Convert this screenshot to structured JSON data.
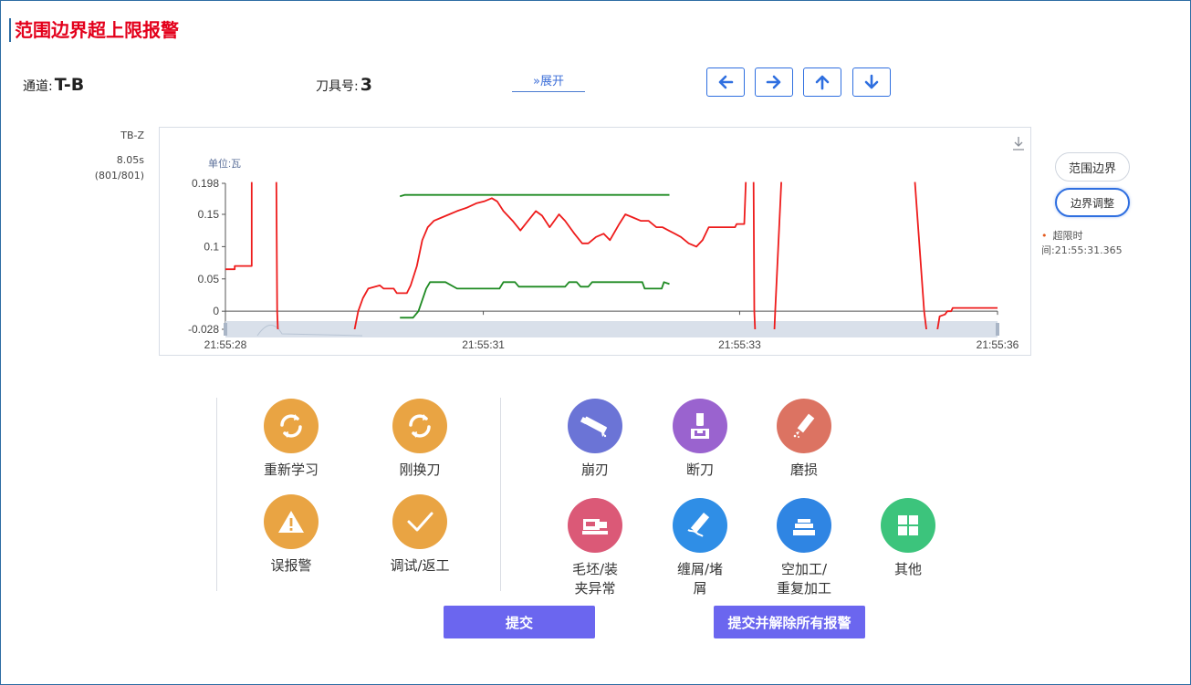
{
  "title": "范围边界超上限报警",
  "channel": {
    "label": "通道:",
    "value": "T-B"
  },
  "tool": {
    "label": "刀具号:",
    "value": "3"
  },
  "expand_label": "»展开",
  "side": {
    "name": "TB-Z",
    "time": "8.05s",
    "count": "(801/801)"
  },
  "buttons": {
    "range": "范围边界",
    "adjust": "边界调整"
  },
  "overlimit": {
    "line1": "超限时",
    "line2": "间:21:55:31.365"
  },
  "options_left": [
    {
      "label": "重新学习",
      "icon": "refresh-icon"
    },
    {
      "label": "刚换刀",
      "icon": "refresh-icon"
    },
    {
      "label": "误报警",
      "icon": "warning-icon"
    },
    {
      "label": "调试/返工",
      "icon": "check-icon"
    }
  ],
  "options_right": [
    {
      "label": "崩刃",
      "icon": "chipped-tool-icon"
    },
    {
      "label": "断刀",
      "icon": "broken-tool-icon"
    },
    {
      "label": "磨损",
      "icon": "wear-icon"
    },
    {
      "label1": "毛坯/装",
      "label2": "夹异常",
      "icon": "blank-clamp-icon"
    },
    {
      "label1": "缠屑/堵",
      "label2": "屑",
      "icon": "chip-jam-icon"
    },
    {
      "label1": "空加工/",
      "label2": "重复加工",
      "icon": "empty-machining-icon"
    },
    {
      "label": "其他",
      "icon": "grid-icon"
    }
  ],
  "colors": {
    "orange": "#e9a443",
    "blue_violet": "#6b74d6",
    "purple": "#9a63cf",
    "salmon": "#dc7362",
    "pink": "#db5977",
    "sky": "#2f8ee6",
    "blue": "#2f85e3",
    "green": "#3cc47c",
    "series_red": "#ee1c1c",
    "series_green": "#1e8a22",
    "submit": "#6b66ef"
  },
  "submit": {
    "label": "提交",
    "label_all": "提交并解除所有报警"
  },
  "chart_data": {
    "type": "line",
    "unit_label": "单位:瓦",
    "x_ticks": [
      "21:55:28",
      "21:55:31",
      "21:55:33",
      "21:55:36"
    ],
    "y_ticks": [
      "0.198",
      "0.15",
      "0.1",
      "0.05",
      "0",
      "-0.028"
    ],
    "ylim": [
      -0.028,
      0.198
    ],
    "series": [
      {
        "color": "#ee1c1c",
        "segments": [
          [
            [
              0.0,
              0.065
            ],
            [
              0.012,
              0.065
            ],
            [
              0.012,
              0.07
            ],
            [
              0.034,
              0.07
            ],
            [
              0.034,
              0.2
            ]
          ],
          [
            [
              0.066,
              0.2
            ],
            [
              0.067,
              0.0
            ],
            [
              0.068,
              -0.03
            ]
          ],
          [
            [
              0.167,
              -0.03
            ],
            [
              0.172,
              0.0
            ],
            [
              0.178,
              0.02
            ],
            [
              0.185,
              0.035
            ],
            [
              0.2,
              0.04
            ],
            [
              0.205,
              0.035
            ],
            [
              0.218,
              0.035
            ],
            [
              0.222,
              0.028
            ],
            [
              0.235,
              0.028
            ],
            [
              0.24,
              0.04
            ],
            [
              0.248,
              0.07
            ],
            [
              0.255,
              0.11
            ],
            [
              0.262,
              0.13
            ],
            [
              0.27,
              0.14
            ],
            [
              0.28,
              0.145
            ],
            [
              0.29,
              0.15
            ],
            [
              0.3,
              0.155
            ],
            [
              0.312,
              0.16
            ],
            [
              0.325,
              0.167
            ],
            [
              0.335,
              0.17
            ],
            [
              0.345,
              0.175
            ],
            [
              0.352,
              0.17
            ],
            [
              0.36,
              0.155
            ],
            [
              0.372,
              0.14
            ],
            [
              0.382,
              0.125
            ],
            [
              0.392,
              0.14
            ],
            [
              0.402,
              0.155
            ],
            [
              0.41,
              0.148
            ],
            [
              0.42,
              0.13
            ],
            [
              0.432,
              0.15
            ],
            [
              0.44,
              0.14
            ],
            [
              0.452,
              0.12
            ],
            [
              0.462,
              0.105
            ],
            [
              0.47,
              0.105
            ],
            [
              0.48,
              0.115
            ],
            [
              0.49,
              0.12
            ],
            [
              0.498,
              0.11
            ],
            [
              0.51,
              0.135
            ],
            [
              0.518,
              0.15
            ],
            [
              0.528,
              0.145
            ],
            [
              0.538,
              0.14
            ],
            [
              0.548,
              0.14
            ],
            [
              0.558,
              0.13
            ],
            [
              0.566,
              0.13
            ],
            [
              0.574,
              0.125
            ],
            [
              0.582,
              0.12
            ],
            [
              0.59,
              0.115
            ],
            [
              0.6,
              0.105
            ],
            [
              0.61,
              0.1
            ],
            [
              0.618,
              0.11
            ],
            [
              0.626,
              0.13
            ],
            [
              0.66,
              0.13
            ],
            [
              0.662,
              0.135
            ],
            [
              0.672,
              0.135
            ],
            [
              0.674,
              0.2
            ]
          ],
          [
            [
              0.684,
              0.2
            ],
            [
              0.685,
              0.0
            ],
            [
              0.686,
              -0.03
            ]
          ],
          [
            [
              0.711,
              -0.03
            ],
            [
              0.712,
              0.0
            ],
            [
              0.72,
              0.2
            ]
          ],
          [
            [
              0.893,
              0.2
            ],
            [
              0.905,
              0.0
            ],
            [
              0.908,
              -0.03
            ]
          ],
          [
            [
              0.922,
              -0.03
            ],
            [
              0.925,
              -0.008
            ],
            [
              0.932,
              -0.005
            ],
            [
              0.935,
              0.0
            ],
            [
              0.94,
              0.0
            ],
            [
              0.942,
              0.005
            ],
            [
              1.0,
              0.005
            ]
          ]
        ]
      },
      {
        "color": "#1e8a22",
        "segments": [
          [
            [
              0.226,
              0.178
            ],
            [
              0.232,
              0.18
            ],
            [
              0.575,
              0.18
            ]
          ],
          [
            [
              0.226,
              -0.01
            ],
            [
              0.243,
              -0.01
            ],
            [
              0.25,
              0.0
            ],
            [
              0.26,
              0.035
            ],
            [
              0.265,
              0.045
            ],
            [
              0.285,
              0.045
            ],
            [
              0.3,
              0.035
            ],
            [
              0.355,
              0.035
            ],
            [
              0.36,
              0.045
            ],
            [
              0.375,
              0.045
            ],
            [
              0.38,
              0.038
            ],
            [
              0.44,
              0.038
            ],
            [
              0.445,
              0.045
            ],
            [
              0.455,
              0.045
            ],
            [
              0.46,
              0.038
            ],
            [
              0.47,
              0.038
            ],
            [
              0.475,
              0.045
            ],
            [
              0.54,
              0.045
            ],
            [
              0.543,
              0.035
            ],
            [
              0.565,
              0.035
            ],
            [
              0.568,
              0.045
            ],
            [
              0.575,
              0.042
            ]
          ]
        ]
      }
    ]
  }
}
